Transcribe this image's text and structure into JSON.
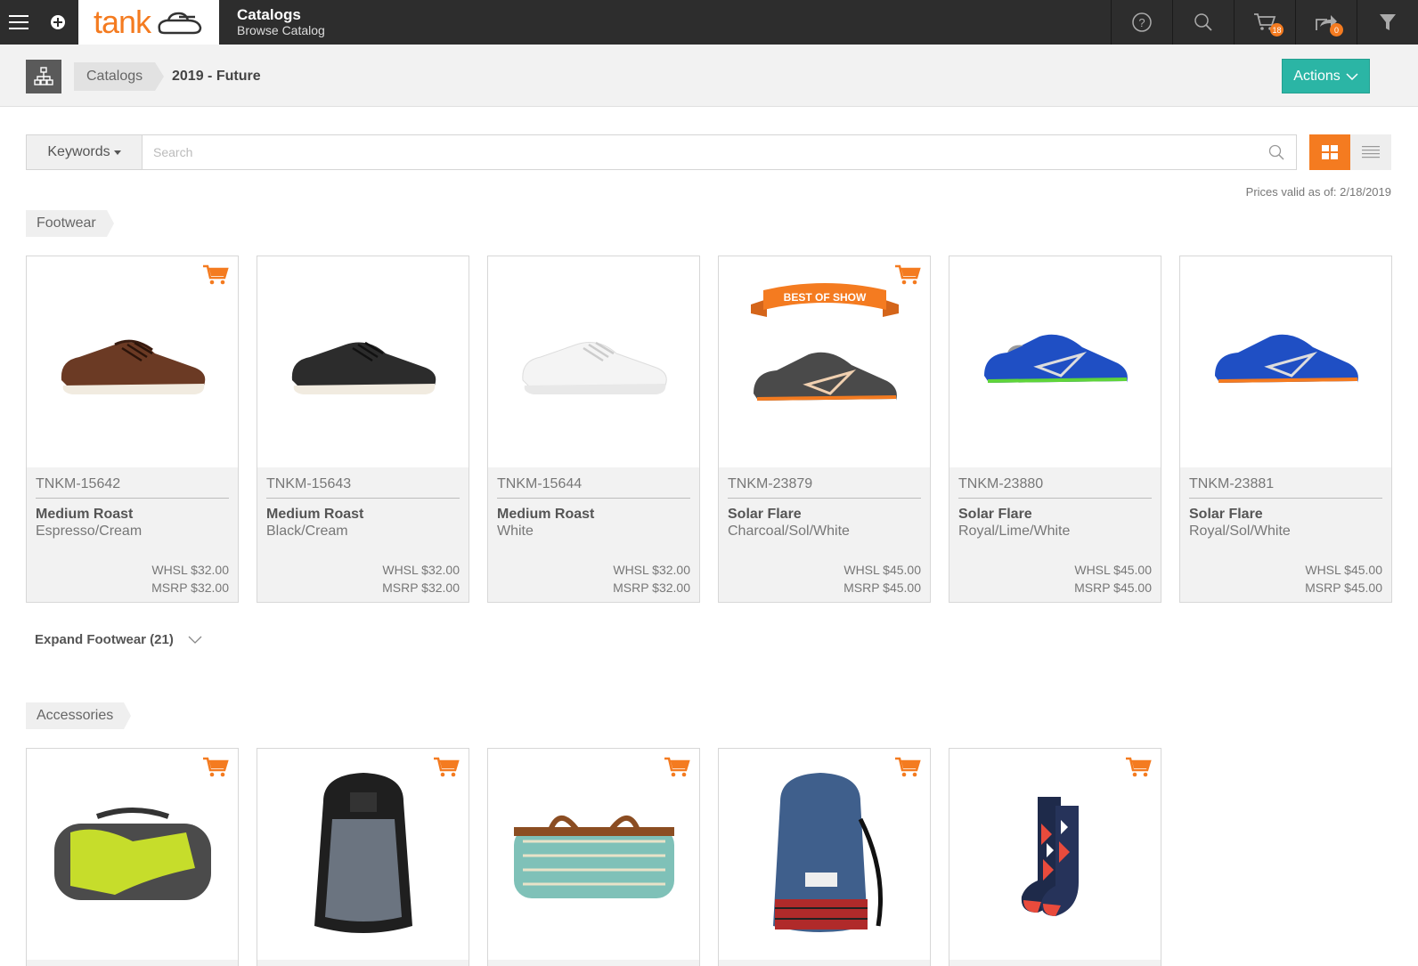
{
  "topbar": {
    "logo_text": "tank",
    "title": "Catalogs",
    "subtitle": "Browse Catalog",
    "cart_count": "18",
    "share_count": "0",
    "accent": "#f47b20"
  },
  "breadcrumb": {
    "root": "Catalogs",
    "current": "2019 - Future"
  },
  "actions_label": "Actions",
  "search": {
    "filter_label": "Keywords",
    "placeholder": "Search"
  },
  "prices_valid": "Prices valid as of: 2/18/2019",
  "sections": {
    "footwear": {
      "label": "Footwear",
      "expand_label": "Expand Footwear (21)",
      "products": [
        {
          "sku": "TNKM-15642",
          "name": "Medium Roast",
          "color": "Espresso/Cream",
          "whsl": "WHSL $32.00",
          "msrp": "MSRP $32.00",
          "image": "brown-sneaker"
        },
        {
          "sku": "TNKM-15643",
          "name": "Medium Roast",
          "color": "Black/Cream",
          "whsl": "WHSL $32.00",
          "msrp": "MSRP $32.00",
          "image": "black-sneaker"
        },
        {
          "sku": "TNKM-15644",
          "name": "Medium Roast",
          "color": "White",
          "whsl": "WHSL $32.00",
          "msrp": "MSRP $32.00",
          "image": "white-sneaker"
        },
        {
          "sku": "TNKM-23879",
          "name": "Solar Flare",
          "color": "Charcoal/Sol/White",
          "whsl": "WHSL $45.00",
          "msrp": "MSRP $45.00",
          "image": "charcoal-running-shoe",
          "ribbon": "BEST OF SHOW"
        },
        {
          "sku": "TNKM-23880",
          "name": "Solar Flare",
          "color": "Royal/Lime/White",
          "whsl": "WHSL $45.00",
          "msrp": "MSRP $45.00",
          "image": "royal-lime-running-shoe"
        },
        {
          "sku": "TNKM-23881",
          "name": "Solar Flare",
          "color": "Royal/Sol/White",
          "whsl": "WHSL $45.00",
          "msrp": "MSRP $45.00",
          "image": "royal-orange-running-shoe"
        }
      ]
    },
    "accessories": {
      "label": "Accessories",
      "products": [
        {
          "image": "duffel-bag-lime"
        },
        {
          "image": "backpack-grey"
        },
        {
          "image": "duffel-bag-striped"
        },
        {
          "image": "backpack-denim"
        },
        {
          "image": "socks-pattern"
        }
      ]
    }
  }
}
